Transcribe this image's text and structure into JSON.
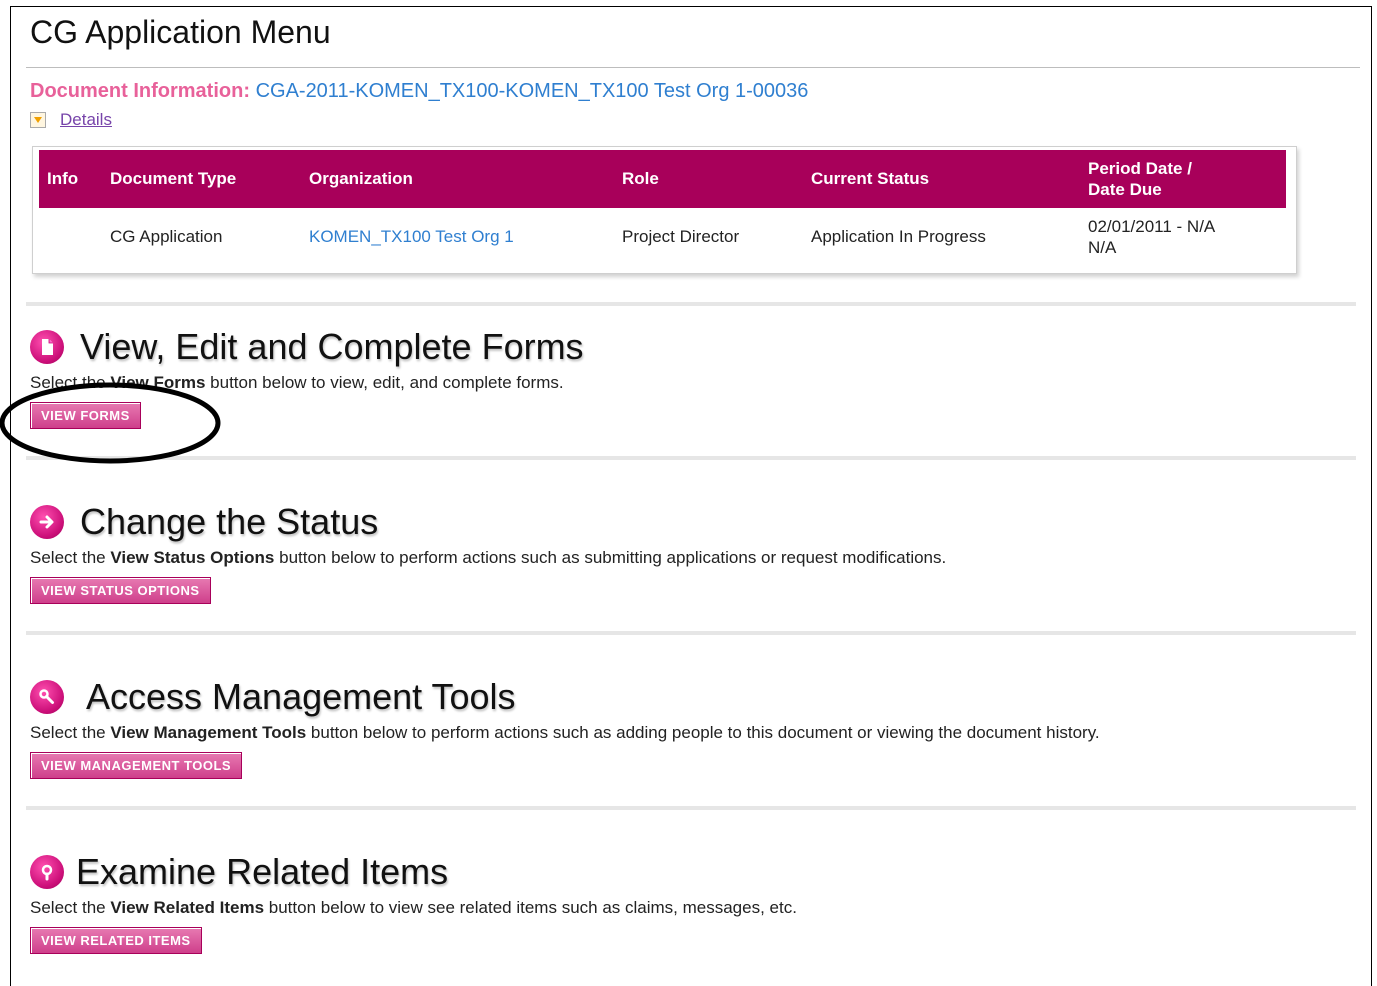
{
  "page": {
    "title": "CG Application Menu"
  },
  "document_info": {
    "label": "Document Information:",
    "id": "CGA-2011-KOMEN_TX100-KOMEN_TX100 Test Org 1-00036",
    "details_link": "Details"
  },
  "doc_table": {
    "headers": [
      "Info",
      "Document Type",
      "Organization",
      "Role",
      "Current Status",
      "Period Date /",
      "Date Due"
    ],
    "row": {
      "info": "",
      "document_type": "CG Application",
      "organization": "KOMEN_TX100 Test Org 1",
      "role": "Project Director",
      "current_status": "Application In Progress",
      "period_date": "02/01/2011 - N/A",
      "date_due": "N/A"
    }
  },
  "sections": [
    {
      "title": "View, Edit and Complete Forms",
      "desc_pre": "Select the ",
      "desc_bold": "View Forms",
      "desc_post": " button below to view, edit, and complete forms.",
      "button": "VIEW FORMS",
      "icon": "document-icon"
    },
    {
      "title": "Change the Status",
      "desc_pre": "Select the ",
      "desc_bold": "View Status Options",
      "desc_post": " button below to perform actions such as submitting applications or request modifications.",
      "button": "VIEW STATUS OPTIONS",
      "icon": "arrow-right-icon"
    },
    {
      "title": "Access Management Tools",
      "desc_pre": "Select the ",
      "desc_bold": "View Management Tools",
      "desc_post": " button below to perform actions such as adding people to this document or viewing the document history.",
      "button": "VIEW MANAGEMENT TOOLS",
      "icon": "wrench-icon"
    },
    {
      "title": "Examine Related Items",
      "desc_pre": "Select the ",
      "desc_bold": "View Related Items",
      "desc_post": " button below to view see related items such as claims, messages, etc.",
      "button": "VIEW RELATED ITEMS",
      "icon": "magnifier-icon"
    }
  ],
  "colors": {
    "accent": "#a8005a",
    "pink_label": "#e8619a",
    "link": "#2f7fd0"
  }
}
